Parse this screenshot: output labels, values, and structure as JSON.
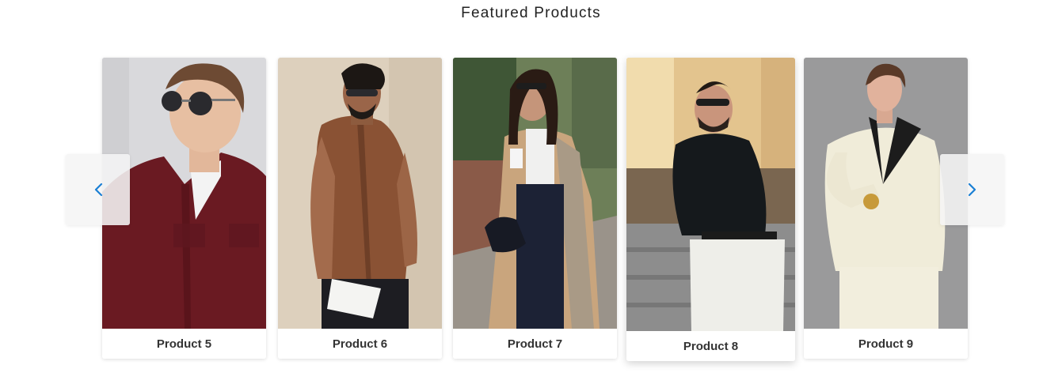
{
  "section": {
    "title": "Featured Products"
  },
  "carousel": {
    "prev_icon": "chevron-left-icon",
    "next_icon": "chevron-right-icon",
    "accent_color": "#1a7fd4",
    "products": [
      {
        "name": "Product 5"
      },
      {
        "name": "Product 6"
      },
      {
        "name": "Product 7"
      },
      {
        "name": "Product 8"
      },
      {
        "name": "Product 9"
      }
    ]
  }
}
